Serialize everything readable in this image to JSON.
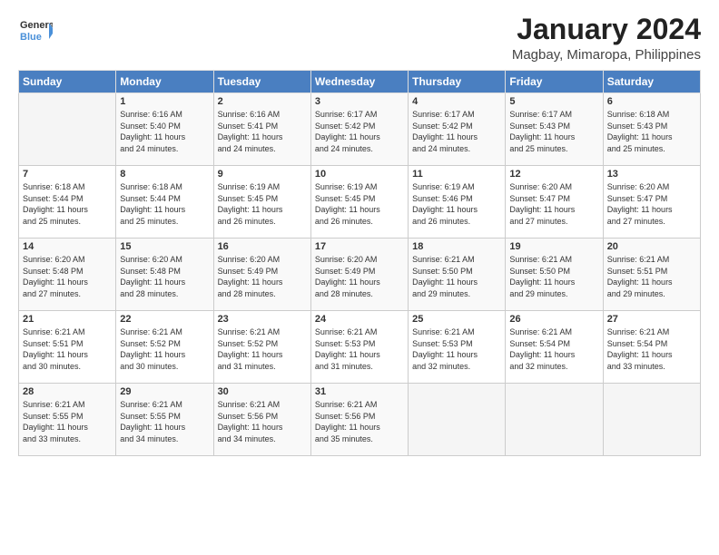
{
  "logo": {
    "general": "General",
    "blue": "Blue"
  },
  "title": "January 2024",
  "subtitle": "Magbay, Mimaropa, Philippines",
  "days_of_week": [
    "Sunday",
    "Monday",
    "Tuesday",
    "Wednesday",
    "Thursday",
    "Friday",
    "Saturday"
  ],
  "weeks": [
    [
      {
        "day": "",
        "info": ""
      },
      {
        "day": "1",
        "info": "Sunrise: 6:16 AM\nSunset: 5:40 PM\nDaylight: 11 hours\nand 24 minutes."
      },
      {
        "day": "2",
        "info": "Sunrise: 6:16 AM\nSunset: 5:41 PM\nDaylight: 11 hours\nand 24 minutes."
      },
      {
        "day": "3",
        "info": "Sunrise: 6:17 AM\nSunset: 5:42 PM\nDaylight: 11 hours\nand 24 minutes."
      },
      {
        "day": "4",
        "info": "Sunrise: 6:17 AM\nSunset: 5:42 PM\nDaylight: 11 hours\nand 24 minutes."
      },
      {
        "day": "5",
        "info": "Sunrise: 6:17 AM\nSunset: 5:43 PM\nDaylight: 11 hours\nand 25 minutes."
      },
      {
        "day": "6",
        "info": "Sunrise: 6:18 AM\nSunset: 5:43 PM\nDaylight: 11 hours\nand 25 minutes."
      }
    ],
    [
      {
        "day": "7",
        "info": "Sunrise: 6:18 AM\nSunset: 5:44 PM\nDaylight: 11 hours\nand 25 minutes."
      },
      {
        "day": "8",
        "info": "Sunrise: 6:18 AM\nSunset: 5:44 PM\nDaylight: 11 hours\nand 25 minutes."
      },
      {
        "day": "9",
        "info": "Sunrise: 6:19 AM\nSunset: 5:45 PM\nDaylight: 11 hours\nand 26 minutes."
      },
      {
        "day": "10",
        "info": "Sunrise: 6:19 AM\nSunset: 5:45 PM\nDaylight: 11 hours\nand 26 minutes."
      },
      {
        "day": "11",
        "info": "Sunrise: 6:19 AM\nSunset: 5:46 PM\nDaylight: 11 hours\nand 26 minutes."
      },
      {
        "day": "12",
        "info": "Sunrise: 6:20 AM\nSunset: 5:47 PM\nDaylight: 11 hours\nand 27 minutes."
      },
      {
        "day": "13",
        "info": "Sunrise: 6:20 AM\nSunset: 5:47 PM\nDaylight: 11 hours\nand 27 minutes."
      }
    ],
    [
      {
        "day": "14",
        "info": "Sunrise: 6:20 AM\nSunset: 5:48 PM\nDaylight: 11 hours\nand 27 minutes."
      },
      {
        "day": "15",
        "info": "Sunrise: 6:20 AM\nSunset: 5:48 PM\nDaylight: 11 hours\nand 28 minutes."
      },
      {
        "day": "16",
        "info": "Sunrise: 6:20 AM\nSunset: 5:49 PM\nDaylight: 11 hours\nand 28 minutes."
      },
      {
        "day": "17",
        "info": "Sunrise: 6:20 AM\nSunset: 5:49 PM\nDaylight: 11 hours\nand 28 minutes."
      },
      {
        "day": "18",
        "info": "Sunrise: 6:21 AM\nSunset: 5:50 PM\nDaylight: 11 hours\nand 29 minutes."
      },
      {
        "day": "19",
        "info": "Sunrise: 6:21 AM\nSunset: 5:50 PM\nDaylight: 11 hours\nand 29 minutes."
      },
      {
        "day": "20",
        "info": "Sunrise: 6:21 AM\nSunset: 5:51 PM\nDaylight: 11 hours\nand 29 minutes."
      }
    ],
    [
      {
        "day": "21",
        "info": "Sunrise: 6:21 AM\nSunset: 5:51 PM\nDaylight: 11 hours\nand 30 minutes."
      },
      {
        "day": "22",
        "info": "Sunrise: 6:21 AM\nSunset: 5:52 PM\nDaylight: 11 hours\nand 30 minutes."
      },
      {
        "day": "23",
        "info": "Sunrise: 6:21 AM\nSunset: 5:52 PM\nDaylight: 11 hours\nand 31 minutes."
      },
      {
        "day": "24",
        "info": "Sunrise: 6:21 AM\nSunset: 5:53 PM\nDaylight: 11 hours\nand 31 minutes."
      },
      {
        "day": "25",
        "info": "Sunrise: 6:21 AM\nSunset: 5:53 PM\nDaylight: 11 hours\nand 32 minutes."
      },
      {
        "day": "26",
        "info": "Sunrise: 6:21 AM\nSunset: 5:54 PM\nDaylight: 11 hours\nand 32 minutes."
      },
      {
        "day": "27",
        "info": "Sunrise: 6:21 AM\nSunset: 5:54 PM\nDaylight: 11 hours\nand 33 minutes."
      }
    ],
    [
      {
        "day": "28",
        "info": "Sunrise: 6:21 AM\nSunset: 5:55 PM\nDaylight: 11 hours\nand 33 minutes."
      },
      {
        "day": "29",
        "info": "Sunrise: 6:21 AM\nSunset: 5:55 PM\nDaylight: 11 hours\nand 34 minutes."
      },
      {
        "day": "30",
        "info": "Sunrise: 6:21 AM\nSunset: 5:56 PM\nDaylight: 11 hours\nand 34 minutes."
      },
      {
        "day": "31",
        "info": "Sunrise: 6:21 AM\nSunset: 5:56 PM\nDaylight: 11 hours\nand 35 minutes."
      },
      {
        "day": "",
        "info": ""
      },
      {
        "day": "",
        "info": ""
      },
      {
        "day": "",
        "info": ""
      }
    ]
  ]
}
